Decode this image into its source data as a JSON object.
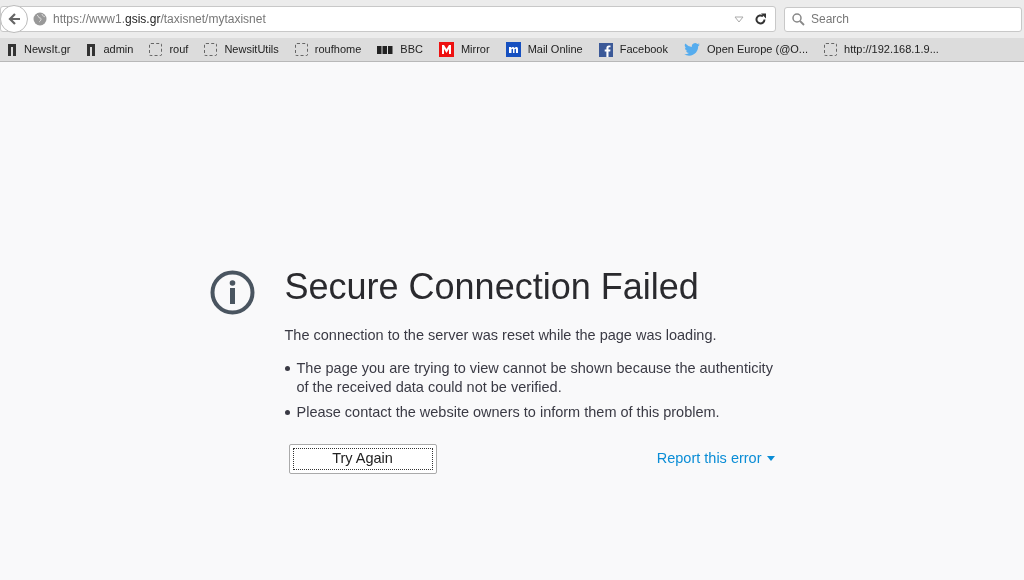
{
  "toolbar": {
    "url": "https://www1.**gsis.gr**/taxisnet/mytaxisnet",
    "search": {
      "placeholder": "Search"
    }
  },
  "bookmarks": [
    {
      "label": "NewsIt.gr",
      "kind": "newsit"
    },
    {
      "label": "admin",
      "kind": "newsit"
    },
    {
      "label": "rouf",
      "kind": "blank"
    },
    {
      "label": "NewsitUtils",
      "kind": "blank"
    },
    {
      "label": "roufhome",
      "kind": "blank"
    },
    {
      "label": "BBC",
      "kind": "bbc"
    },
    {
      "label": "Mirror",
      "kind": "mirror"
    },
    {
      "label": "Mail Online",
      "kind": "mail"
    },
    {
      "label": "Facebook",
      "kind": "facebook"
    },
    {
      "label": "Open Europe (@O...",
      "kind": "twitter"
    },
    {
      "label": "http://192.168.1.9...",
      "kind": "blank"
    }
  ],
  "error": {
    "title": "Secure Connection Failed",
    "description": "The connection to the server was reset while the page was loading.",
    "bullets": [
      "The page you are trying to view cannot be shown because the authenticity of the received data could not be verified.",
      "Please contact the website owners to inform them of this problem."
    ],
    "button": "Try Again",
    "report_link": "Report this error"
  }
}
